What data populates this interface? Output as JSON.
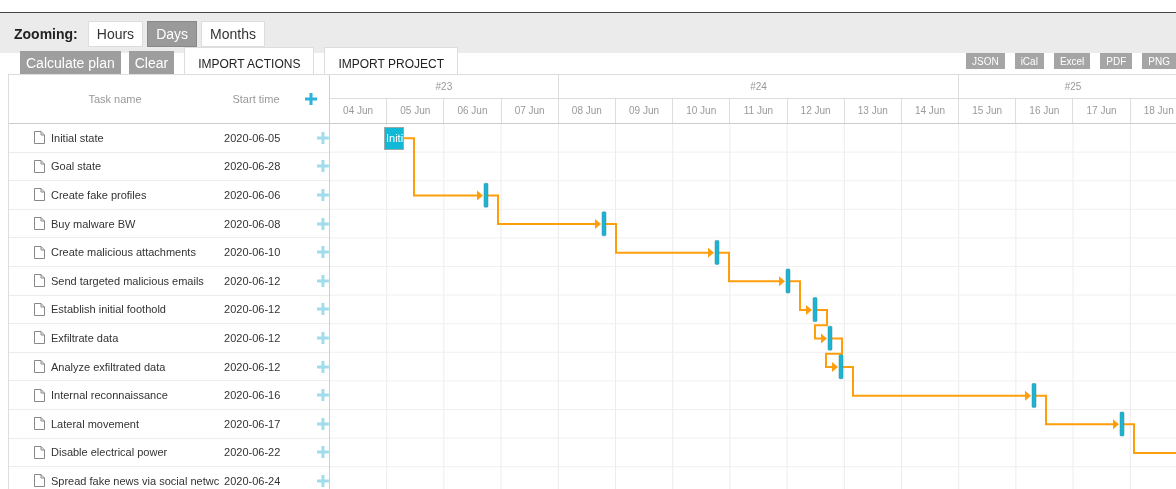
{
  "toolbar": {
    "zoom_label": "Zooming:",
    "zoom_options": [
      {
        "label": "Hours",
        "selected": false
      },
      {
        "label": "Days",
        "selected": true
      },
      {
        "label": "Months",
        "selected": false
      }
    ],
    "actions": [
      "Calculate plan",
      "Clear"
    ],
    "tabs": [
      {
        "label": "IMPORT ACTIONS"
      },
      {
        "label": "IMPORT PROJECT"
      }
    ],
    "exports": [
      "JSON",
      "iCal",
      "Excel",
      "PDF",
      "PNG"
    ]
  },
  "grid": {
    "columns": [
      "Task name",
      "Start time"
    ],
    "tasks": [
      {
        "name": "Initial state",
        "start_time": "2020-06-05",
        "bar": {
          "kind": "task",
          "label": "Initi"
        },
        "link_out": true
      },
      {
        "name": "Goal state",
        "start_time": "2020-06-28"
      },
      {
        "name": "Create fake profiles",
        "start_time": "2020-06-06",
        "bar": {
          "kind": "milestone"
        },
        "link_out": true
      },
      {
        "name": "Buy malware BW",
        "start_time": "2020-06-08",
        "bar": {
          "kind": "milestone"
        },
        "link_out": true
      },
      {
        "name": "Create malicious attachments",
        "start_time": "2020-06-10",
        "bar": {
          "kind": "milestone"
        },
        "link_out": true
      },
      {
        "name": "Send targeted malicious emails",
        "start_time": "2020-06-12",
        "bar": {
          "kind": "milestone"
        },
        "link_out": true
      },
      {
        "name": "Establish initial foothold",
        "start_time": "2020-06-12",
        "bar": {
          "kind": "milestone"
        },
        "link_out": true
      },
      {
        "name": "Exfiltrate data",
        "start_time": "2020-06-12",
        "bar": {
          "kind": "milestone"
        },
        "link_out": true
      },
      {
        "name": "Analyze exfiltrated data",
        "start_time": "2020-06-12",
        "bar": {
          "kind": "milestone"
        },
        "link_out": true
      },
      {
        "name": "Internal reconnaissance",
        "start_time": "2020-06-16",
        "bar": {
          "kind": "milestone"
        },
        "link_out": true
      },
      {
        "name": "Lateral movement",
        "start_time": "2020-06-17",
        "bar": {
          "kind": "milestone"
        },
        "link_out": true
      },
      {
        "name": "Disable electrical power",
        "start_time": "2020-06-22"
      },
      {
        "name": "Spread fake news via social netwc",
        "start_time": "2020-06-24"
      }
    ]
  },
  "timeline": {
    "weeks": [
      {
        "label": "#23",
        "days": [
          "04 Jun",
          "05 Jun",
          "06 Jun",
          "07 Jun"
        ]
      },
      {
        "label": "#24",
        "days": [
          "08 Jun",
          "09 Jun",
          "10 Jun",
          "11 Jun",
          "12 Jun",
          "13 Jun",
          "14 Jun"
        ]
      },
      {
        "label": "#25",
        "days": [
          "15 Jun",
          "16 Jun",
          "17 Jun",
          "18 Jun"
        ]
      }
    ]
  }
}
